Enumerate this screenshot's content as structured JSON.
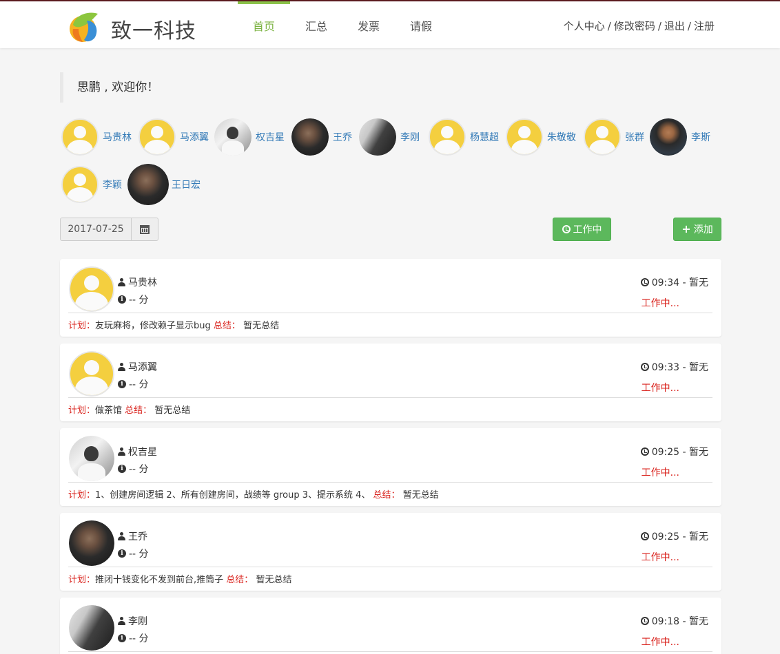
{
  "header": {
    "brand": "致一科技",
    "nav": [
      "首页",
      "汇总",
      "发票",
      "请假"
    ],
    "user_links": [
      "个人中心",
      "修改密码",
      "退出",
      "注册"
    ],
    "separator": "/"
  },
  "welcome": "思鹏 , 欢迎你！",
  "members": [
    {
      "name": "马贵林",
      "avatar": "placeholder"
    },
    {
      "name": "马添翼",
      "avatar": "placeholder"
    },
    {
      "name": "权吉星",
      "avatar": "photo"
    },
    {
      "name": "王乔",
      "avatar": "photo"
    },
    {
      "name": "李刚",
      "avatar": "photo"
    },
    {
      "name": "杨慧超",
      "avatar": "placeholder"
    },
    {
      "name": "朱敬敬",
      "avatar": "placeholder"
    },
    {
      "name": "张群",
      "avatar": "placeholder"
    },
    {
      "name": "李斯",
      "avatar": "photo"
    },
    {
      "name": "李颖",
      "avatar": "placeholder"
    },
    {
      "name": "王日宏",
      "avatar": "photo"
    }
  ],
  "date_value": "2017-07-25",
  "buttons": {
    "working": "工作中",
    "add": "添加"
  },
  "labels": {
    "plan": "计划：",
    "summary": "总结：",
    "score_unit": "-- 分"
  },
  "records": [
    {
      "name": "马贵林",
      "time": "09:34 - 暂无",
      "status": "工作中...",
      "plan": "友玩麻将，修改赖子显示bug",
      "summary": "暂无总结",
      "avatar": "placeholder"
    },
    {
      "name": "马添翼",
      "time": "09:33 - 暂无",
      "status": "工作中...",
      "plan": "做茶馆",
      "summary": "暂无总结",
      "avatar": "placeholder"
    },
    {
      "name": "权吉星",
      "time": "09:25 - 暂无",
      "status": "工作中...",
      "plan": "1、创建房间逻辑 2、所有创建房间，战绩等 group 3、提示系统 4、",
      "summary": "暂无总结",
      "avatar": "photo"
    },
    {
      "name": "王乔",
      "time": "09:25 - 暂无",
      "status": "工作中...",
      "plan": "推闭十钱变化不发到前台,推筒子",
      "summary": "暂无总结",
      "avatar": "photo"
    },
    {
      "name": "李刚",
      "time": "09:18 - 暂无",
      "status": "工作中...",
      "plan": "",
      "summary": "",
      "avatar": "photo"
    }
  ],
  "colors": {
    "accent": "#8bc34a",
    "button_green": "#5cb85c",
    "link_blue": "#337ab7",
    "status_red": "#d9211b",
    "avatar_yellow": "#f4cf3f"
  }
}
